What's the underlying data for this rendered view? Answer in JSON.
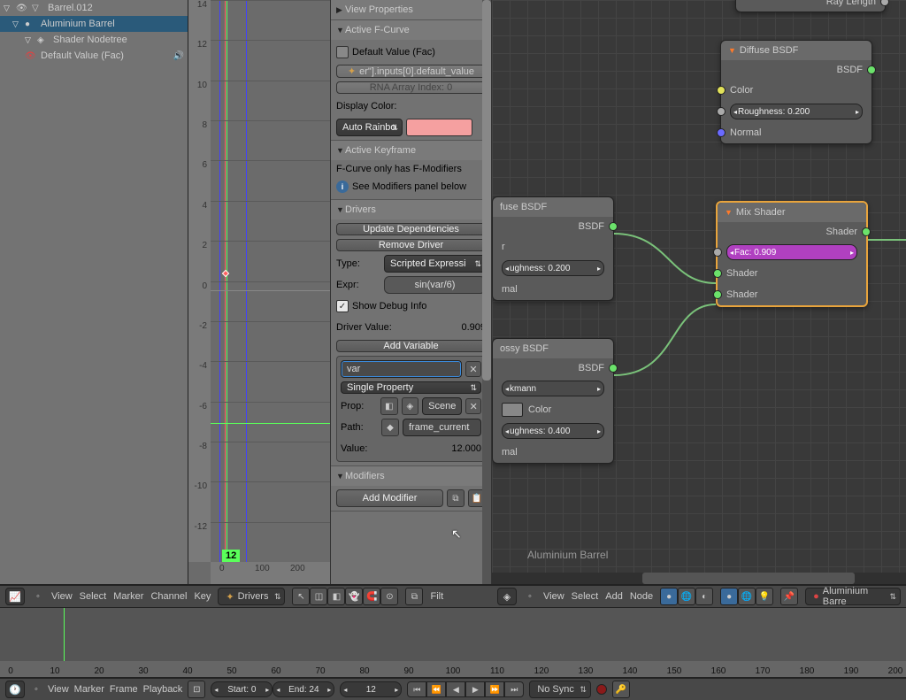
{
  "outliner": {
    "items": [
      {
        "label": "Barrel.012",
        "indent": 0
      },
      {
        "label": "Aluminium Barrel",
        "indent": 1
      },
      {
        "label": "Shader Nodetree",
        "indent": 2
      },
      {
        "label": "Default Value (Fac)",
        "indent": 3
      }
    ]
  },
  "graph": {
    "y_ticks": [
      "14",
      "12",
      "10",
      "8",
      "6",
      "4",
      "2",
      "0",
      "-2",
      "-4",
      "-6",
      "-8",
      "-10",
      "-12"
    ],
    "x_ticks": [
      "0",
      "100",
      "200"
    ],
    "current_frame": "12"
  },
  "npanel": {
    "view_properties": "View Properties",
    "active_fcurve": "Active F-Curve",
    "fcurve_name": "Default Value (Fac)",
    "rna_path": "er\"].inputs[0].default_value",
    "rna_index": "RNA Array Index: 0",
    "display_color": "Display Color:",
    "color_mode": "Auto Rainbo",
    "active_keyframe": "Active Keyframe",
    "fmod_only": "F-Curve only has F-Modifiers",
    "see_modifiers": "See Modifiers panel below",
    "drivers": "Drivers",
    "update_deps": "Update Dependencies",
    "remove_driver": "Remove Driver",
    "type_label": "Type:",
    "type_value": "Scripted Expressi",
    "expr_label": "Expr:",
    "expr_value": "sin(var/6)",
    "show_debug": "Show Debug Info",
    "driver_value_label": "Driver Value:",
    "driver_value": "0.909",
    "add_variable": "Add Variable",
    "var_name": "var",
    "var_type": "Single Property",
    "prop_label": "Prop:",
    "prop_value": "Scene",
    "path_label": "Path:",
    "path_value": "frame_current",
    "value_label": "Value:",
    "value": "12.000",
    "modifiers": "Modifiers",
    "add_modifier": "Add Modifier"
  },
  "nodes": {
    "diffuse1": {
      "title": "Diffuse BSDF",
      "out": "BSDF",
      "color": "Color",
      "rough": "Roughness: 0.200",
      "normal": "Normal"
    },
    "diffuse2": {
      "title": "fuse BSDF",
      "out": "BSDF",
      "color": "r",
      "rough": "ughness: 0.200",
      "normal": "mal"
    },
    "glossy": {
      "title": "ossy BSDF",
      "out": "BSDF",
      "dist": "kmann",
      "color": "Color",
      "rough": "ughness: 0.400",
      "normal": "mal"
    },
    "ray": {
      "out": "Ray Length"
    },
    "mix": {
      "title": "Mix Shader",
      "out": "Shader",
      "fac": "Fac: 0.909",
      "sh1": "Shader",
      "sh2": "Shader"
    },
    "label": "Aluminium Barrel"
  },
  "graph_header": {
    "menus": [
      "View",
      "Select",
      "Marker",
      "Channel",
      "Key"
    ],
    "mode": "Drivers",
    "filter": "Filt"
  },
  "node_header": {
    "menus": [
      "View",
      "Select",
      "Add",
      "Node"
    ],
    "material": "Aluminium Barre"
  },
  "timeline": {
    "ticks": [
      "0",
      "10",
      "20",
      "30",
      "40",
      "50",
      "60",
      "70",
      "80",
      "90",
      "100",
      "110",
      "120",
      "130",
      "140",
      "150",
      "160",
      "170",
      "180",
      "190",
      "200"
    ],
    "menus": [
      "View",
      "Marker",
      "Frame",
      "Playback"
    ],
    "start": "Start: 0",
    "end": "End: 24",
    "current": "12",
    "sync": "No Sync"
  }
}
